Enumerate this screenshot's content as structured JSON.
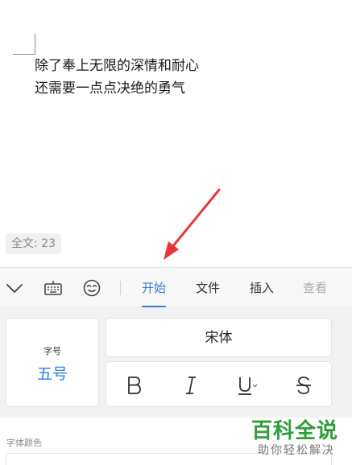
{
  "document": {
    "lines": [
      "除了奉上无限的深情和耐心",
      "还需要一点点决绝的勇气"
    ],
    "word_count": "全文: 23"
  },
  "toolbar": {
    "icons": [
      "collapse-chevron-icon",
      "keyboard-icon",
      "emoji-icon"
    ],
    "tabs": [
      {
        "label": "开始",
        "active": true
      },
      {
        "label": "文件",
        "active": false
      },
      {
        "label": "插入",
        "active": false
      },
      {
        "label": "查看",
        "active": false
      }
    ]
  },
  "format_panel": {
    "font_size_label": "字号",
    "font_size_value": "五号",
    "font_name": "宋体",
    "style_buttons": [
      "bold-icon",
      "italic-icon",
      "underline-icon",
      "strikethrough-icon"
    ],
    "font_color_label": "字体颜色"
  },
  "watermark": {
    "title": "百科全说",
    "subtitle": "助你轻松解决"
  },
  "colors": {
    "accent": "#2d7fe0",
    "annotation_arrow": "#e53935",
    "watermark_green": "#2e9d3a"
  }
}
